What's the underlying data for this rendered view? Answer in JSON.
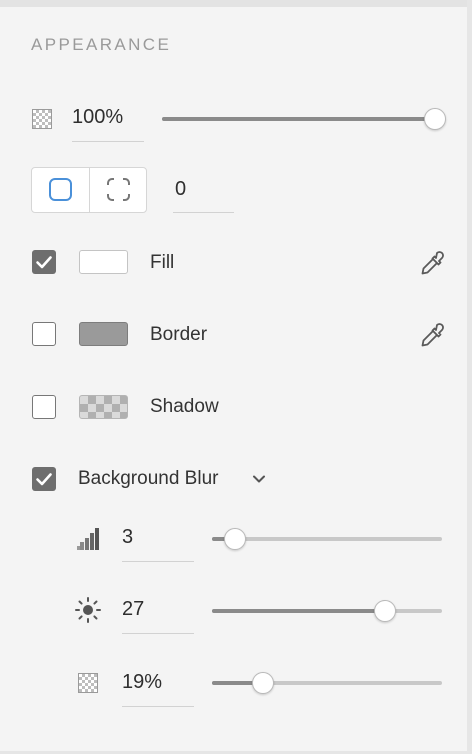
{
  "section": {
    "title": "APPEARANCE"
  },
  "opacity": {
    "value": "100%",
    "level": 1.0
  },
  "corner_radius": {
    "value": "0",
    "mode": "uniform"
  },
  "fill": {
    "label": "Fill",
    "checked": true,
    "color": "#ffffff",
    "icon": "eyedropper-icon"
  },
  "border": {
    "label": "Border",
    "checked": false,
    "color": "#9a9a9a",
    "icon": "eyedropper-icon"
  },
  "shadow": {
    "label": "Shadow",
    "checked": false
  },
  "background_blur": {
    "label": "Background Blur",
    "checked": true,
    "blur_amount": {
      "value": "3",
      "level": 0.1,
      "icon": "blur-amount-icon"
    },
    "brightness": {
      "value": "27",
      "level": 0.75,
      "icon": "brightness-icon"
    },
    "opacity": {
      "value": "19%",
      "level": 0.22,
      "icon": "checkerboard-icon"
    }
  },
  "colors": {
    "accent": "#4a90d9",
    "checkbox_on": "#6e6e6e"
  }
}
